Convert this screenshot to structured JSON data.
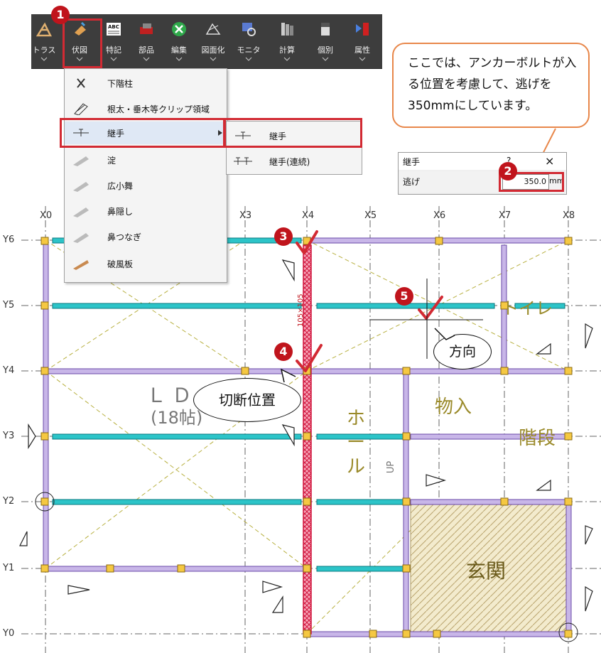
{
  "toolbar": {
    "items": [
      {
        "label": "トラス",
        "icon": "truss-icon"
      },
      {
        "label": "伏図",
        "icon": "framing-plan-icon"
      },
      {
        "label": "特記",
        "icon": "abc-note-icon"
      },
      {
        "label": "部品",
        "icon": "parts-icon"
      },
      {
        "label": "編集",
        "icon": "edit-tools-icon"
      },
      {
        "label": "図面化",
        "icon": "drawing-icon"
      },
      {
        "label": "モニタ",
        "icon": "monitor-icon"
      },
      {
        "label": "計算",
        "icon": "calc-icon"
      },
      {
        "label": "個別",
        "icon": "individual-icon"
      },
      {
        "label": "属性",
        "icon": "attribute-icon"
      }
    ]
  },
  "menu": {
    "items": [
      {
        "label": "下階柱"
      },
      {
        "label": "根太・垂木等クリップ領域"
      },
      {
        "label": "継手",
        "has_submenu": true
      },
      {
        "label": "淀"
      },
      {
        "label": "広小舞"
      },
      {
        "label": "鼻隠し"
      },
      {
        "label": "鼻つなぎ"
      },
      {
        "label": "破風板"
      }
    ],
    "submenu": [
      {
        "label": "継手"
      },
      {
        "label": "継手(連続)"
      }
    ]
  },
  "dialog": {
    "title": "継手",
    "help": "?",
    "close": "×",
    "field_label": "逃げ",
    "field_value": "350.0",
    "unit": "mm"
  },
  "callout": {
    "text": "ここでは、アンカーボルトが入る位置を考慮して、逃げを350mmにしています。"
  },
  "steps": [
    "1",
    "2",
    "3",
    "4",
    "5"
  ],
  "bubbles": {
    "direction": "方向",
    "cut_position": "切断位置"
  },
  "plan": {
    "x_axes": [
      "X0",
      "X3",
      "X4",
      "X5",
      "X6",
      "X7",
      "X8"
    ],
    "y_axes": [
      "Y6",
      "Y5",
      "Y4",
      "Y3",
      "Y2",
      "Y1",
      "Y0"
    ],
    "dimension": "105×105",
    "rooms": {
      "ldk": "ＬＤＫ",
      "ldk_sub": "(18帖)",
      "hall": "ホール",
      "storage": "物入",
      "stairs": "階段",
      "toilet": "トイレ",
      "entrance": "玄関",
      "up": "UP"
    }
  },
  "colors": {
    "beam_purple": "#c8b6e8",
    "beam_cyan": "#2cc4c8",
    "highlight_red": "#d22a33",
    "cut_member": "#f06a8a",
    "accent_orange": "#e8874a",
    "grid_line": "#555555"
  }
}
